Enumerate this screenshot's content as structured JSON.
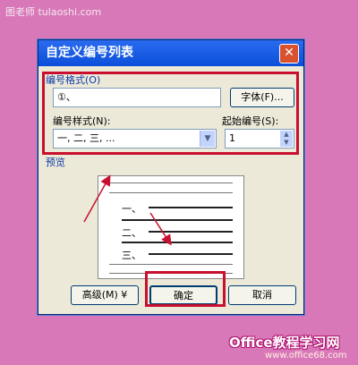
{
  "watermark_top": "图老师 tulaoshi.com",
  "dialog": {
    "title": "自定义编号列表",
    "close_symbol": "✕",
    "number_format_label": "编号格式(O)",
    "number_format_value": "①、",
    "font_button": "字体(F)...",
    "number_style_label": "编号样式(N):",
    "number_style_value": "一, 二, 三, ...",
    "start_at_label": "起始编号(S):",
    "start_at_value": "1",
    "preview_label": "预览",
    "preview_items": [
      "一、",
      "二、",
      "三、"
    ],
    "advanced_button": "高级(M) ¥",
    "ok_button": "确定",
    "cancel_button": "取消"
  },
  "watermark_bottom": "Office教程学习网",
  "watermark_bottom_url": "www.office68.com",
  "colors": {
    "highlight": "#c8102e",
    "titlebar": "#0b4ed9"
  }
}
